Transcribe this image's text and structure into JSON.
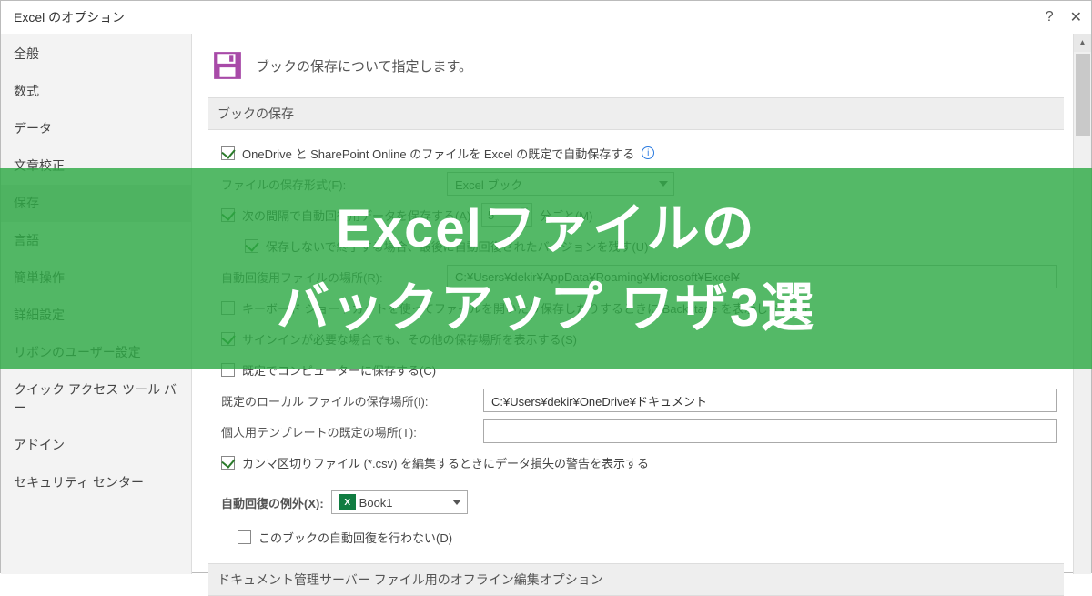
{
  "titlebar": {
    "title": "Excel のオプション"
  },
  "sidebar": {
    "items": [
      {
        "label": "全般"
      },
      {
        "label": "数式"
      },
      {
        "label": "データ"
      },
      {
        "label": "文章校正"
      },
      {
        "label": "保存"
      },
      {
        "label": "言語"
      },
      {
        "label": "簡単操作"
      },
      {
        "label": "詳細設定"
      },
      {
        "label": "リボンのユーザー設定"
      },
      {
        "label": "クイック アクセス ツール バー"
      },
      {
        "label": "アドイン"
      },
      {
        "label": "セキュリティ センター"
      }
    ],
    "selected_index": 4
  },
  "main": {
    "header": "ブックの保存について指定します。",
    "section1_title": "ブックの保存",
    "onedrive_auto": "OneDrive と SharePoint Online のファイルを Excel の既定で自動保存する",
    "file_format_label": "ファイルの保存形式(F):",
    "file_format_value": "Excel ブック",
    "autorecover_prefix": "次の間隔で自動回復用データを保存する(A):",
    "autorecover_value": "5",
    "autorecover_suffix": "分ごと(M)",
    "keep_last_label": "保存しないで終了する場合、最後に自動回復されたバージョンを残す(U)",
    "autorecover_loc_label": "自動回復用ファイルの場所(R):",
    "autorecover_loc_value": "C:¥Users¥dekir¥AppData¥Roaming¥Microsoft¥Excel¥",
    "backstage_label": "キーボード ショートカットを使ってファイルを開いたり保存したりするときに Backstage を表示しない(S)",
    "signin_label": "サインインが必要な場合でも、その他の保存場所を表示する(S)",
    "default_pc_label": "既定でコンピューターに保存する(C)",
    "default_local_label": "既定のローカル ファイルの保存場所(I):",
    "default_local_value": "C:¥Users¥dekir¥OneDrive¥ドキュメント",
    "template_loc_label": "個人用テンプレートの既定の場所(T):",
    "template_loc_value": "",
    "csv_warn_label": "カンマ区切りファイル (*.csv) を編集するときにデータ損失の警告を表示する",
    "section2_title": "自動回復の例外(X):",
    "book_value": "Book1",
    "disable_autorec_label": "このブックの自動回復を行わない(D)",
    "section3_title": "ドキュメント管理サーバー ファイル用のオフライン編集オプション"
  },
  "overlay": {
    "line1": "Excelファイルの",
    "line2": "バックアップ ワザ3選"
  }
}
